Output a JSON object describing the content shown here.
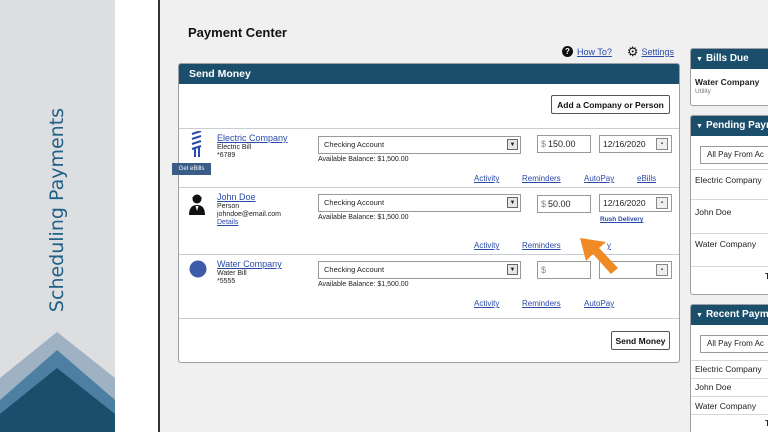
{
  "slide": {
    "title": "Scheduling Payments"
  },
  "page": {
    "title": "Payment Center"
  },
  "top_links": {
    "help_label": "How To?",
    "settings_label": "Settings"
  },
  "send_money": {
    "header": "Send Money",
    "add_button": "Add a Company or Person",
    "send_button": "Send Money",
    "get_ebills": "Get eBills",
    "payees": [
      {
        "name": "Electric Company",
        "type": "Electric Bill",
        "detail": "*6789",
        "icon": "bill-icon",
        "account": "Checking Account",
        "balance": "Available Balance: $1,500.00",
        "currency": "$",
        "amount": "150.00",
        "date": "12/16/2020",
        "actions": [
          "Activity",
          "Reminders",
          "AutoPay",
          "eBills"
        ]
      },
      {
        "name": "John Doe",
        "type": "Person",
        "detail": "johndoe@email.com",
        "details_link": "Details",
        "icon": "person-icon",
        "account": "Checking Account",
        "balance": "Available Balance: $1,500.00",
        "currency": "$",
        "amount": "50.00",
        "date": "12/16/2020",
        "rush": "Rush Delivery",
        "actions": [
          "Activity",
          "Reminders",
          "y"
        ]
      },
      {
        "name": "Water Company",
        "type": "Water Bill",
        "detail": "*5555",
        "icon": "circle-icon",
        "account": "Checking Account",
        "balance": "Available Balance: $1,500.00",
        "currency": "$",
        "amount": "",
        "date": "",
        "actions": [
          "Activity",
          "Reminders",
          "AutoPay"
        ]
      }
    ]
  },
  "sidebar": {
    "bills_due": {
      "title": "Bills Due",
      "item": "Water Company",
      "item_sub": "Utility"
    },
    "pending": {
      "title": "Pending Paym",
      "select": "All Pay From Ac",
      "items": [
        "Electric Company",
        "John Doe",
        "Water Company"
      ],
      "footer": "T"
    },
    "recent": {
      "title": "Recent Payme",
      "select": "All Pay From Ac",
      "items": [
        "Electric Company",
        "John Doe",
        "Water Company"
      ],
      "footer": "T"
    }
  },
  "colors": {
    "header": "#1b4e6b",
    "link": "#2a4aa8",
    "accent_cursor": "#f08a24",
    "slide_text": "#1f5f88"
  }
}
